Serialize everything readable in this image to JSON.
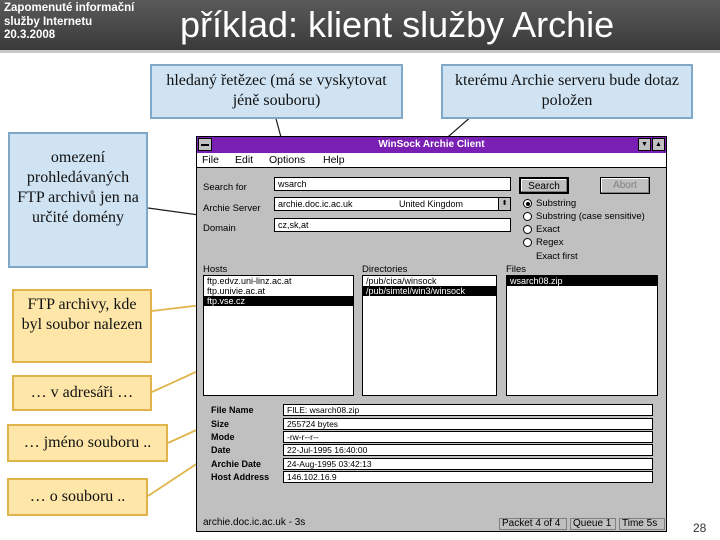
{
  "header": {
    "course_line1": "Zapomenuté informační",
    "course_line2": "služby Internetu",
    "course_date": "20.3.2008",
    "title": "příklad: klient služby Archie"
  },
  "callouts": {
    "search_string": "hledaný řetězec (má se vyskytovat jéně souboru)",
    "server": "kterému Archie serveru bude dotaz položen",
    "domain": "omezení prohledávaných FTP archivů jen na určité domény",
    "ftp_archives": "FTP archivy, kde byl soubor nalezen",
    "directory": "… v adresáři …",
    "filename": "… jméno souboru ..",
    "about_file": "… o souboru .."
  },
  "window": {
    "title": "WinSock Archie Client",
    "menu": [
      "File",
      "Edit",
      "Options",
      "Help"
    ],
    "search_label": "Search for",
    "search_value": "wsarch",
    "server_label": "Archie Server",
    "server_value": "archie.doc.ic.ac.uk",
    "server_country": "United Kingdom",
    "domain_label": "Domain",
    "domain_value": "cz,sk,at",
    "search_button": "Search",
    "abort_button": "Abort",
    "match_options": [
      "Substring",
      "Substring (case sensitive)",
      "Exact",
      "Regex"
    ],
    "selected_option": "Substring",
    "exact_first_label": "Exact first",
    "hosts_label": "Hosts",
    "hosts": [
      "ftp.edvz.uni-linz.ac.at",
      "ftp.univie.ac.at",
      "ftp.vse.cz"
    ],
    "selected_host": "ftp.vse.cz",
    "directories_label": "Directories",
    "directories": [
      "/pub/cica/winsock",
      "/pub/simtel/win3/winsock"
    ],
    "selected_directory": "/pub/simtel/win3/winsock",
    "files_label": "Files",
    "files": [
      "wsarch08.zip"
    ],
    "selected_file": "wsarch08.zip",
    "details": [
      {
        "label": "File Name",
        "value": "FILE: wsarch08.zip"
      },
      {
        "label": "Size",
        "value": "255724 bytes"
      },
      {
        "label": "Mode",
        "value": "-rw-r--r--"
      },
      {
        "label": "Date",
        "value": "22-Jul-1995 16:40:00"
      },
      {
        "label": "Archie Date",
        "value": "24-Aug-1995 03:42:13"
      },
      {
        "label": "Host Address",
        "value": "146.102.16.9"
      }
    ],
    "status_main": "archie.doc.ic.ac.uk - 3s",
    "status_packet": "Packet 4 of 4",
    "status_queue": "Queue 1",
    "status_time": "Time 5s"
  },
  "page_number": "28",
  "colors": {
    "header_bg": "#4a4a4a",
    "titlebar": "#7a1fb3",
    "callout_blue": "#cfe3f3",
    "callout_yellow": "#fde6a8",
    "window_face": "#c0c0c0"
  }
}
